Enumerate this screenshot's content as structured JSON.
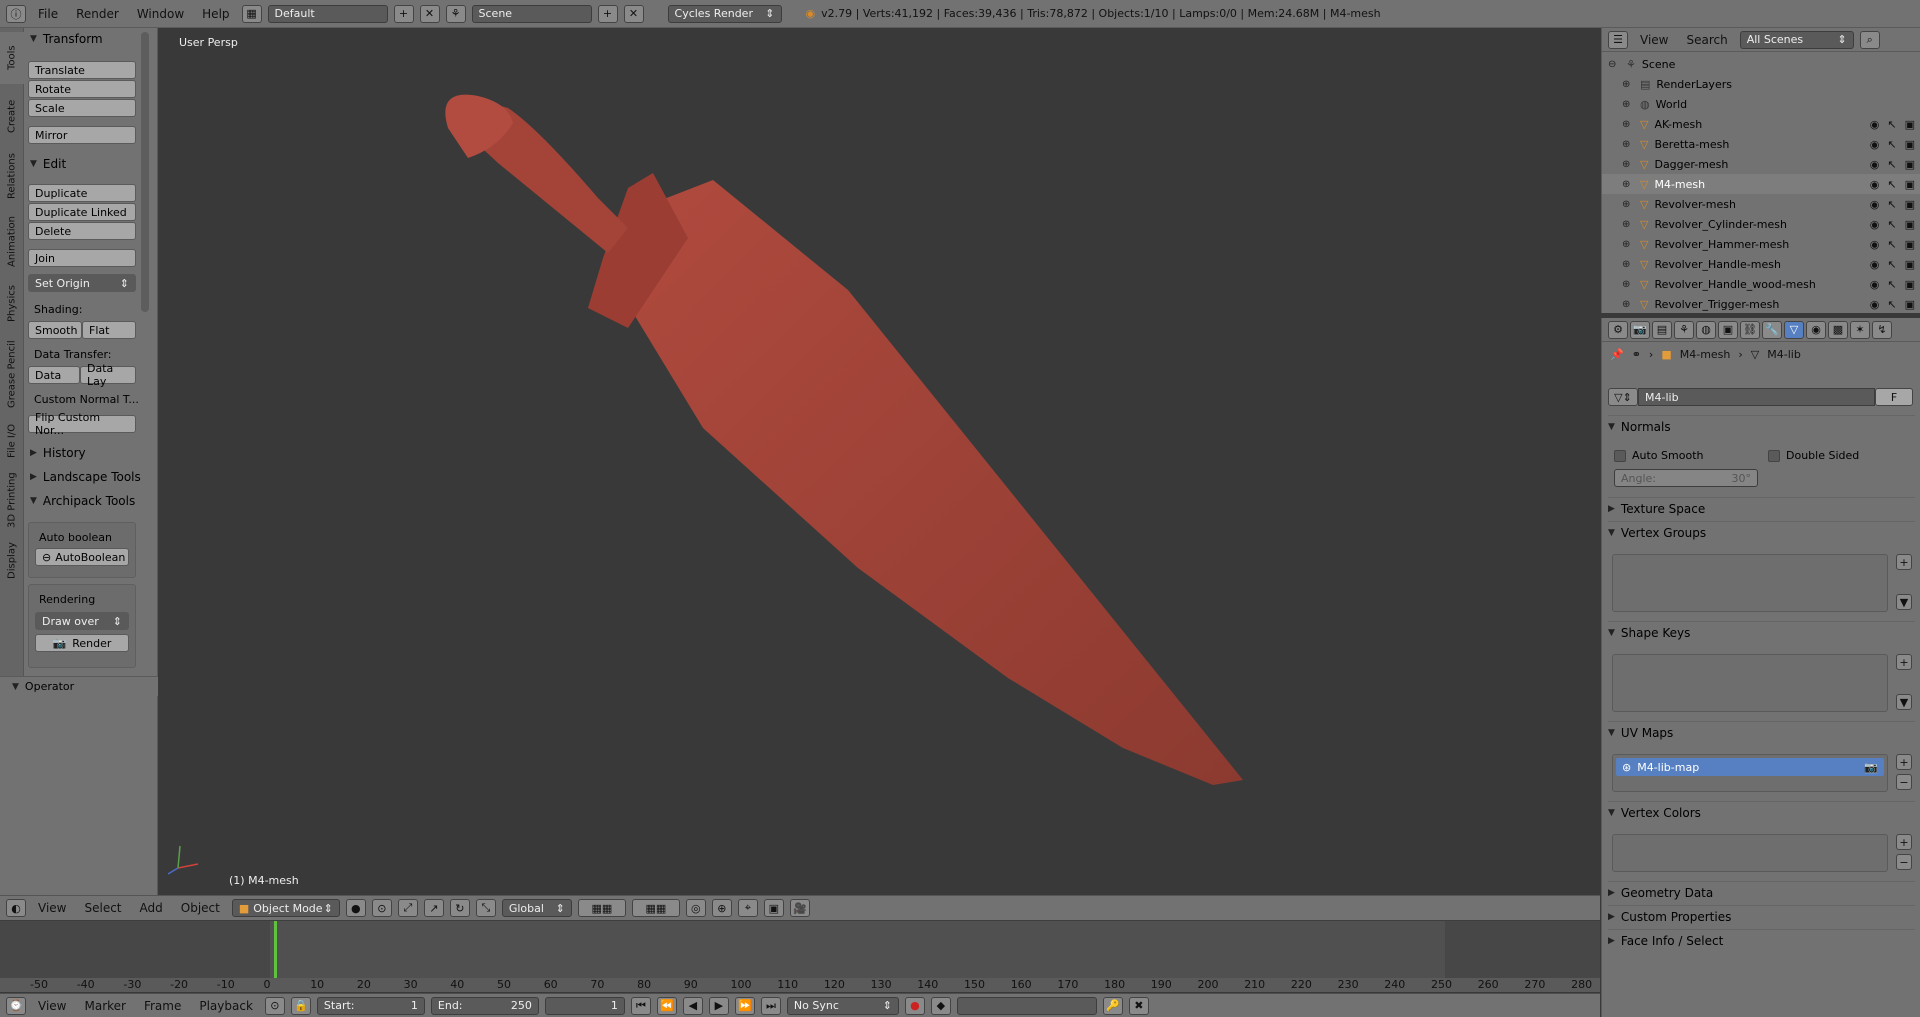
{
  "top_bar": {
    "menus": [
      "File",
      "Render",
      "Window",
      "Help"
    ],
    "screen_layout": "Default",
    "scene": "Scene",
    "render_engine": "Cycles Render",
    "stats": "v2.79 | Verts:41,192 | Faces:39,436 | Tris:78,872 | Objects:1/10 | Lamps:0/0 | Mem:24.68M | M4-mesh"
  },
  "left_tabs": [
    "Tools",
    "Create",
    "Relations",
    "Animation",
    "Physics",
    "Grease Pencil",
    "File I/O",
    "3D Printing",
    "Display"
  ],
  "tools_panel": {
    "transform_header": "Transform",
    "transform_buttons": [
      "Translate",
      "Rotate",
      "Scale"
    ],
    "mirror_label": "Mirror",
    "edit_header": "Edit",
    "edit_buttons": [
      "Duplicate",
      "Duplicate Linked",
      "Delete"
    ],
    "join_label": "Join",
    "set_origin_label": "Set Origin",
    "shading_label": "Shading:",
    "smooth_label": "Smooth",
    "flat_label": "Flat",
    "data_transfer_label": "Data Transfer:",
    "data_label": "Data",
    "data_lay_label": "Data Lay",
    "custom_normal_label": "Custom Normal T...",
    "flip_custom_label": "Flip Custom Nor...",
    "history_header": "History",
    "landscape_header": "Landscape Tools",
    "archipack_header": "Archipack Tools",
    "auto_boolean_label": "Auto boolean",
    "autoboolean_button": "AutoBoolean",
    "rendering_label": "Rendering",
    "draw_over_label": "Draw over",
    "render_button": "Render",
    "operator_header": "Operator"
  },
  "viewport": {
    "view_label": "User Persp",
    "object_label": "(1) M4-mesh",
    "object_color": "#a0443a",
    "bg_color": "#393939"
  },
  "view_header": {
    "menus": [
      "View",
      "Select",
      "Add",
      "Object"
    ],
    "mode": "Object Mode",
    "orientation": "Global"
  },
  "timeline": {
    "ruler_labels": [
      "-50",
      "-40",
      "-30",
      "-20",
      "-10",
      "0",
      "10",
      "20",
      "30",
      "40",
      "50",
      "60",
      "70",
      "80",
      "90",
      "100",
      "110",
      "120",
      "130",
      "140",
      "150",
      "160",
      "170",
      "180",
      "190",
      "200",
      "210",
      "220",
      "230",
      "240",
      "250",
      "260",
      "270",
      "280"
    ],
    "menus": [
      "View",
      "Marker",
      "Frame",
      "Playback"
    ],
    "start_label": "Start:",
    "start_value": "1",
    "end_label": "End:",
    "end_value": "250",
    "current_frame": "1",
    "sync": "No Sync"
  },
  "outliner": {
    "menus": [
      "View",
      "Search"
    ],
    "filter": "All Scenes",
    "items": [
      {
        "label": "Scene",
        "indent": 0,
        "icon": "scene-icon",
        "vis": false
      },
      {
        "label": "RenderLayers",
        "indent": 1,
        "icon": "renderlayers-icon",
        "vis": false
      },
      {
        "label": "World",
        "indent": 1,
        "icon": "world-icon",
        "vis": false
      },
      {
        "label": "AK-mesh",
        "indent": 1,
        "icon": "mesh-icon",
        "vis": true
      },
      {
        "label": "Beretta-mesh",
        "indent": 1,
        "icon": "mesh-icon",
        "vis": true
      },
      {
        "label": "Dagger-mesh",
        "indent": 1,
        "icon": "mesh-icon",
        "vis": true
      },
      {
        "label": "M4-mesh",
        "indent": 1,
        "icon": "mesh-icon",
        "vis": true,
        "active": true
      },
      {
        "label": "Revolver-mesh",
        "indent": 1,
        "icon": "mesh-icon",
        "vis": true
      },
      {
        "label": "Revolver_Cylinder-mesh",
        "indent": 1,
        "icon": "mesh-icon",
        "vis": true
      },
      {
        "label": "Revolver_Hammer-mesh",
        "indent": 1,
        "icon": "mesh-icon",
        "vis": true
      },
      {
        "label": "Revolver_Handle-mesh",
        "indent": 1,
        "icon": "mesh-icon",
        "vis": true
      },
      {
        "label": "Revolver_Handle_wood-mesh",
        "indent": 1,
        "icon": "mesh-icon",
        "vis": true
      },
      {
        "label": "Revolver_Trigger-mesh",
        "indent": 1,
        "icon": "mesh-icon",
        "vis": true
      }
    ]
  },
  "properties": {
    "breadcrumb_object": "M4-mesh",
    "breadcrumb_data": "M4-lib",
    "datablock_name": "M4-lib",
    "fake_user": "F",
    "normals_header": "Normals",
    "auto_smooth": "Auto Smooth",
    "double_sided": "Double Sided",
    "angle_label": "Angle:",
    "angle_value": "30°",
    "texture_space": "Texture Space",
    "vertex_groups": "Vertex Groups",
    "shape_keys": "Shape Keys",
    "uv_maps": "UV Maps",
    "uv_map_item": "M4-lib-map",
    "vertex_colors": "Vertex Colors",
    "geometry_data": "Geometry Data",
    "custom_properties": "Custom Properties",
    "face_info": "Face Info / Select"
  },
  "colors": {
    "panel": "#727272",
    "button": "#a7a7a7",
    "selected": "#5680c2",
    "active_text": "#ffffff",
    "playhead": "#60c040"
  }
}
